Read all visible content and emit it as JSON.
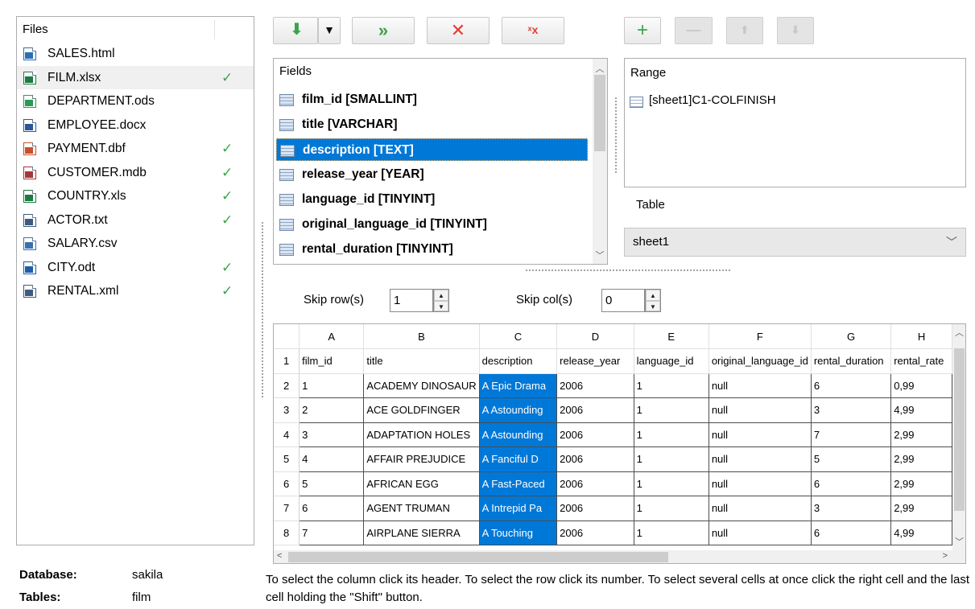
{
  "files_panel": {
    "header": "Files",
    "items": [
      {
        "name": "SALES.html",
        "icon": "html-file-icon",
        "color": "#2a6fb4",
        "checked": false,
        "selected": false
      },
      {
        "name": "FILM.xlsx",
        "icon": "excel-file-icon",
        "color": "#1d7a43",
        "checked": true,
        "selected": true
      },
      {
        "name": "DEPARTMENT.ods",
        "icon": "ods-file-icon",
        "color": "#2b9a56",
        "checked": false,
        "selected": false
      },
      {
        "name": "EMPLOYEE.docx",
        "icon": "word-file-icon",
        "color": "#2b5797",
        "checked": false,
        "selected": false
      },
      {
        "name": "PAYMENT.dbf",
        "icon": "dbf-file-icon",
        "color": "#c8502c",
        "checked": true,
        "selected": false
      },
      {
        "name": "CUSTOMER.mdb",
        "icon": "access-file-icon",
        "color": "#a4373a",
        "checked": true,
        "selected": false
      },
      {
        "name": "COUNTRY.xls",
        "icon": "excel-file-icon",
        "color": "#1d7a43",
        "checked": true,
        "selected": false
      },
      {
        "name": "ACTOR.txt",
        "icon": "txt-file-icon",
        "color": "#3d5a80",
        "checked": true,
        "selected": false
      },
      {
        "name": "SALARY.csv",
        "icon": "csv-file-icon",
        "color": "#3d6fb0",
        "checked": false,
        "selected": false
      },
      {
        "name": "CITY.odt",
        "icon": "odt-file-icon",
        "color": "#1f5fa8",
        "checked": true,
        "selected": false
      },
      {
        "name": "RENTAL.xml",
        "icon": "xml-file-icon",
        "color": "#3d5a80",
        "checked": true,
        "selected": false
      }
    ]
  },
  "database_info": {
    "database_label": "Database:",
    "database_value": "sakila",
    "tables_label": "Tables:",
    "tables_value": "film"
  },
  "toolbar": {
    "left": [
      {
        "name": "add-field-button",
        "icon": "arrow-down-green-icon",
        "glyph": "⬇",
        "enabled": true
      },
      {
        "name": "add-field-dropdown-button",
        "icon": "triangle-down-icon",
        "glyph": "▾",
        "enabled": true
      },
      {
        "name": "add-all-fields-button",
        "icon": "double-arrow-right-icon",
        "glyph": "»",
        "enabled": true
      },
      {
        "name": "remove-field-button",
        "icon": "red-x-icon",
        "glyph": "✕",
        "enabled": true
      },
      {
        "name": "remove-all-fields-button",
        "icon": "small-red-x-icon",
        "glyph": "ˣx",
        "enabled": true
      }
    ],
    "right": [
      {
        "name": "add-range-button",
        "icon": "plus-icon",
        "glyph": "+",
        "enabled": true
      },
      {
        "name": "remove-range-button",
        "icon": "minus-icon",
        "glyph": "—",
        "enabled": false
      },
      {
        "name": "move-up-button",
        "icon": "arrow-up-icon",
        "glyph": "⬆",
        "enabled": false
      },
      {
        "name": "move-down-button",
        "icon": "arrow-down-icon",
        "glyph": "⬇",
        "enabled": false
      }
    ]
  },
  "fields": {
    "title": "Fields",
    "items": [
      {
        "label": "film_id  [SMALLINT]",
        "selected": false
      },
      {
        "label": "title  [VARCHAR]",
        "selected": false
      },
      {
        "label": "description  [TEXT]",
        "selected": true
      },
      {
        "label": "release_year  [YEAR]",
        "selected": false
      },
      {
        "label": "language_id  [TINYINT]",
        "selected": false
      },
      {
        "label": "original_language_id  [TINYINT]",
        "selected": false
      },
      {
        "label": "rental_duration  [TINYINT]",
        "selected": false
      }
    ]
  },
  "range": {
    "title": "Range",
    "value": "[sheet1]C1-COLFINISH"
  },
  "table_select": {
    "label": "Table",
    "value": "sheet1"
  },
  "skip": {
    "rows_label": "Skip row(s)",
    "rows_value": "1",
    "cols_label": "Skip col(s)",
    "cols_value": "0"
  },
  "grid": {
    "columns": [
      "A",
      "B",
      "C",
      "D",
      "E",
      "F",
      "G",
      "H"
    ],
    "column_widths": [
      103,
      104,
      103,
      104,
      103,
      104,
      103,
      80
    ],
    "selected_column": 2,
    "rows": [
      {
        "num": "1",
        "cells": [
          "film_id",
          "title",
          "description",
          "release_year",
          "language_id",
          "original_language_id",
          "rental_duration",
          "rental_rate"
        ]
      },
      {
        "num": "2",
        "cells": [
          "1",
          "ACADEMY DINOSAUR",
          "A Epic Drama",
          "2006",
          "1",
          "null",
          "6",
          "0,99"
        ]
      },
      {
        "num": "3",
        "cells": [
          "2",
          "ACE GOLDFINGER",
          "A Astounding",
          "2006",
          "1",
          "null",
          "3",
          "4,99"
        ]
      },
      {
        "num": "4",
        "cells": [
          "3",
          "ADAPTATION HOLES",
          "A Astounding",
          "2006",
          "1",
          "null",
          "7",
          "2,99"
        ]
      },
      {
        "num": "5",
        "cells": [
          "4",
          "AFFAIR PREJUDICE",
          "A Fanciful D",
          "2006",
          "1",
          "null",
          "5",
          "2,99"
        ]
      },
      {
        "num": "6",
        "cells": [
          "5",
          "AFRICAN EGG",
          "A Fast-Paced",
          "2006",
          "1",
          "null",
          "6",
          "2,99"
        ]
      },
      {
        "num": "7",
        "cells": [
          "6",
          "AGENT TRUMAN",
          "A Intrepid Pa",
          "2006",
          "1",
          "null",
          "3",
          "2,99"
        ]
      },
      {
        "num": "8",
        "cells": [
          "7",
          "AIRPLANE SIERRA",
          "A Touching",
          "2006",
          "1",
          "null",
          "6",
          "4,99"
        ]
      }
    ]
  },
  "hint": "To select the column click its header. To select the row click its number. To select several cells at once click the right cell and the last cell holding the \"Shift\" button.",
  "colors": {
    "selection": "#0078d7",
    "check": "#3fa34d",
    "green_icon": "#3aa44a",
    "red_icon": "#e23c32"
  }
}
